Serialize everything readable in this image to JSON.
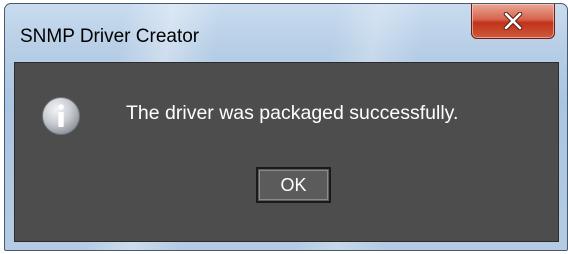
{
  "dialog": {
    "title": "SNMP Driver Creator",
    "message": "The driver was packaged successfully.",
    "ok_label": "OK",
    "icon": "info-icon",
    "close_icon": "close-icon"
  },
  "colors": {
    "client_background": "#4d4d4d",
    "message_text": "#ffffff",
    "close_button": "#c7432a"
  }
}
